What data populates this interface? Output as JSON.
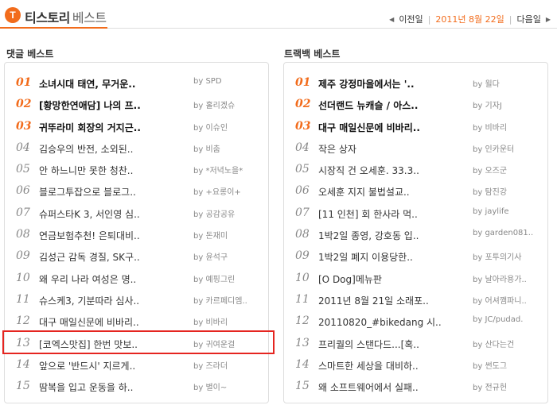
{
  "header": {
    "logo_glyph": "T",
    "brand_main": "티스토리",
    "brand_sub": "베스트",
    "nav": {
      "prev": "이전일",
      "date": "2011년 8월 22일",
      "next": "다음일"
    }
  },
  "comments": {
    "title": "댓글 베스트",
    "items": [
      {
        "rank": "01",
        "title": "소녀시대 태연, 무거운..",
        "by": "by SPD"
      },
      {
        "rank": "02",
        "title": "[황망한연애담] 나의 프..",
        "by": "by 홀리겠슈"
      },
      {
        "rank": "03",
        "title": "귀뚜라미 회장의 거지근..",
        "by": "by 이슈인"
      },
      {
        "rank": "04",
        "title": "김승우의 반전, 소외된..",
        "by": "by 비춤"
      },
      {
        "rank": "05",
        "title": "안 하느니만 못한 청찬..",
        "by": "by *저녁노을*"
      },
      {
        "rank": "06",
        "title": "블로그투잡으로 블로그..",
        "by": "by +요롱이+"
      },
      {
        "rank": "07",
        "title": "슈퍼스타K 3, 서인영 심..",
        "by": "by 공감공유"
      },
      {
        "rank": "08",
        "title": "연금보험추천! 은퇴대비..",
        "by": "by 돈재미"
      },
      {
        "rank": "09",
        "title": "김성근 감독 경질, SK구..",
        "by": "by 윤석구"
      },
      {
        "rank": "10",
        "title": "왜 우리 나라 여성은 명..",
        "by": "by 예핑그린"
      },
      {
        "rank": "11",
        "title": "슈스케3, 기분따라 심사..",
        "by": "by 카르페디엠.."
      },
      {
        "rank": "12",
        "title": "대구 매일신문에 비바리..",
        "by": "by 비바리"
      },
      {
        "rank": "13",
        "title": "[코엑스맛집] 한번 맛보..",
        "by": "by 귀여운걸"
      },
      {
        "rank": "14",
        "title": "앞으로 '반드시' 지르게..",
        "by": "by 즈라더"
      },
      {
        "rank": "15",
        "title": "땀복을 입고 운동을 하..",
        "by": "by 별이~"
      }
    ]
  },
  "trackbacks": {
    "title": "트랙백 베스트",
    "items": [
      {
        "rank": "01",
        "title": "제주 강정마을에서는 '..",
        "by": "by 윌다"
      },
      {
        "rank": "02",
        "title": "선더랜드 뉴캐슬 / 아스..",
        "by": "by 기자J"
      },
      {
        "rank": "03",
        "title": "대구 매일신문에 비바리..",
        "by": "by 비바리"
      },
      {
        "rank": "04",
        "title": "작은 상자",
        "by": "by 인카운터"
      },
      {
        "rank": "05",
        "title": "시장직 건 오세훈. 33.3..",
        "by": "by 오즈군"
      },
      {
        "rank": "06",
        "title": "오세훈 지지 불법설교..",
        "by": "by 탐진강"
      },
      {
        "rank": "07",
        "title": "[11 인천] 회 한사라 먹..",
        "by": "by jaylife"
      },
      {
        "rank": "08",
        "title": "1박2일 종영, 강호동 입..",
        "by": "by garden081.."
      },
      {
        "rank": "09",
        "title": "1박2일 폐지 이용당한..",
        "by": "by 포투의기사"
      },
      {
        "rank": "10",
        "title": "[O Dog]메뉴판",
        "by": "by 날아라용가.."
      },
      {
        "rank": "11",
        "title": "2011년 8월 21일 소래포..",
        "by": "by 어셔깸파니.."
      },
      {
        "rank": "12",
        "title": "20110820_#bikedang 시..",
        "by": "by JC/pudad."
      },
      {
        "rank": "13",
        "title": "프리퀄의 스탠다드...[혹..",
        "by": "by 산다는건"
      },
      {
        "rank": "14",
        "title": "스마트한 세상을 대비하..",
        "by": "by 썬도그"
      },
      {
        "rank": "15",
        "title": "왜 소프트웨어에서 실패..",
        "by": "by 전규헌"
      }
    ]
  }
}
